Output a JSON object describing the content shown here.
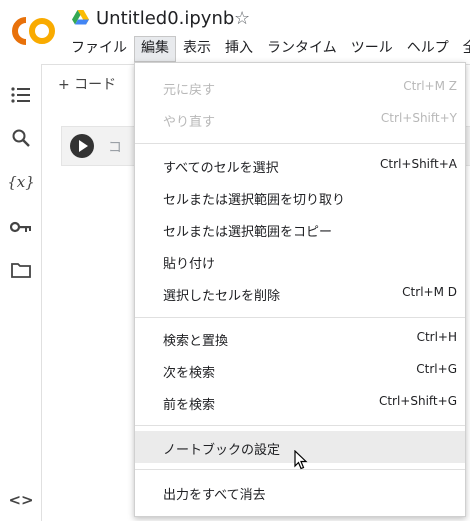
{
  "header": {
    "title": "Untitled0.ipynb",
    "logo_text": "CO",
    "menu": [
      "ファイル",
      "編集",
      "表示",
      "挿入",
      "ランタイム",
      "ツール",
      "ヘルプ",
      "全"
    ]
  },
  "sidebar": {
    "icons": [
      "table-of-contents-icon",
      "search-icon",
      "variables-icon",
      "key-icon",
      "folder-icon",
      "code-snippets-icon"
    ]
  },
  "toolbar": {
    "add_code": "+ コード"
  },
  "cell": {
    "placeholder": "コ"
  },
  "edit_menu": {
    "items": [
      {
        "label": "元に戻す",
        "shortcut": "Ctrl+M Z",
        "disabled": true
      },
      {
        "label": "やり直す",
        "shortcut": "Ctrl+Shift+Y",
        "disabled": true
      },
      {
        "label": "すべてのセルを選択",
        "shortcut": "Ctrl+Shift+A"
      },
      {
        "label": "セルまたは選択範囲を切り取り",
        "shortcut": ""
      },
      {
        "label": "セルまたは選択範囲をコピー",
        "shortcut": ""
      },
      {
        "label": "貼り付け",
        "shortcut": ""
      },
      {
        "label": "選択したセルを削除",
        "shortcut": "Ctrl+M D"
      },
      {
        "label": "検索と置換",
        "shortcut": "Ctrl+H"
      },
      {
        "label": "次を検索",
        "shortcut": "Ctrl+G"
      },
      {
        "label": "前を検索",
        "shortcut": "Ctrl+Shift+G"
      },
      {
        "label": "ノートブックの設定",
        "shortcut": "",
        "hovered": true
      },
      {
        "label": "出力をすべて消去",
        "shortcut": ""
      }
    ]
  },
  "colors": {
    "logo_orange": "#F9AB00",
    "logo_dark": "#E8710A",
    "hover": "#ebebeb"
  }
}
